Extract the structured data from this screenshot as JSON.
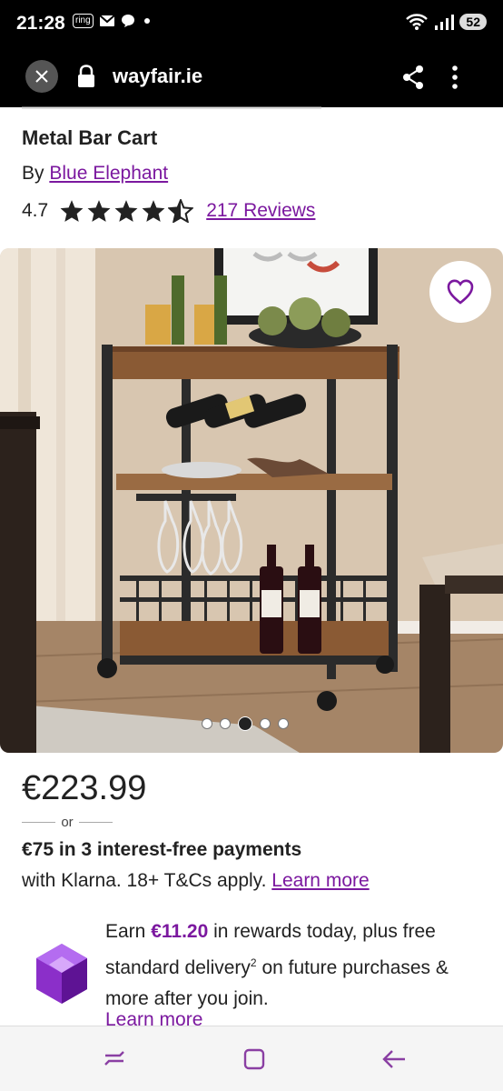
{
  "status_bar": {
    "time": "21:28",
    "ring_label": "ring",
    "battery": "52",
    "wifi_badge": "6"
  },
  "browser": {
    "url": "wayfair.ie"
  },
  "product": {
    "title": "Metal Bar Cart",
    "by_prefix": "By ",
    "brand": "Blue Elephant",
    "rating": "4.7",
    "stars": 4.7,
    "reviews": "217 Reviews",
    "image_pages": 5,
    "active_image": 3
  },
  "pricing": {
    "price": "€223.99",
    "or": "or",
    "installments": "€75 in 3 interest-free payments",
    "klarna_text": "with Klarna. 18+ T&Cs apply. ",
    "learn_more": "Learn more"
  },
  "rewards": {
    "earn": "Earn ",
    "amount": "€11.20",
    "text_a": " in rewards today, plus free standard delivery",
    "superscript": "2",
    "text_b": " on future purchases & more after you join.",
    "learn_more": "Learn more"
  },
  "colors": {
    "accent": "#7b189f",
    "topbar": "#000000"
  },
  "icons": {
    "close": "close-icon",
    "lock": "lock-icon",
    "share": "share-icon",
    "more": "more-vertical-icon",
    "favorite": "heart-icon",
    "rewards": "gem-icon"
  }
}
